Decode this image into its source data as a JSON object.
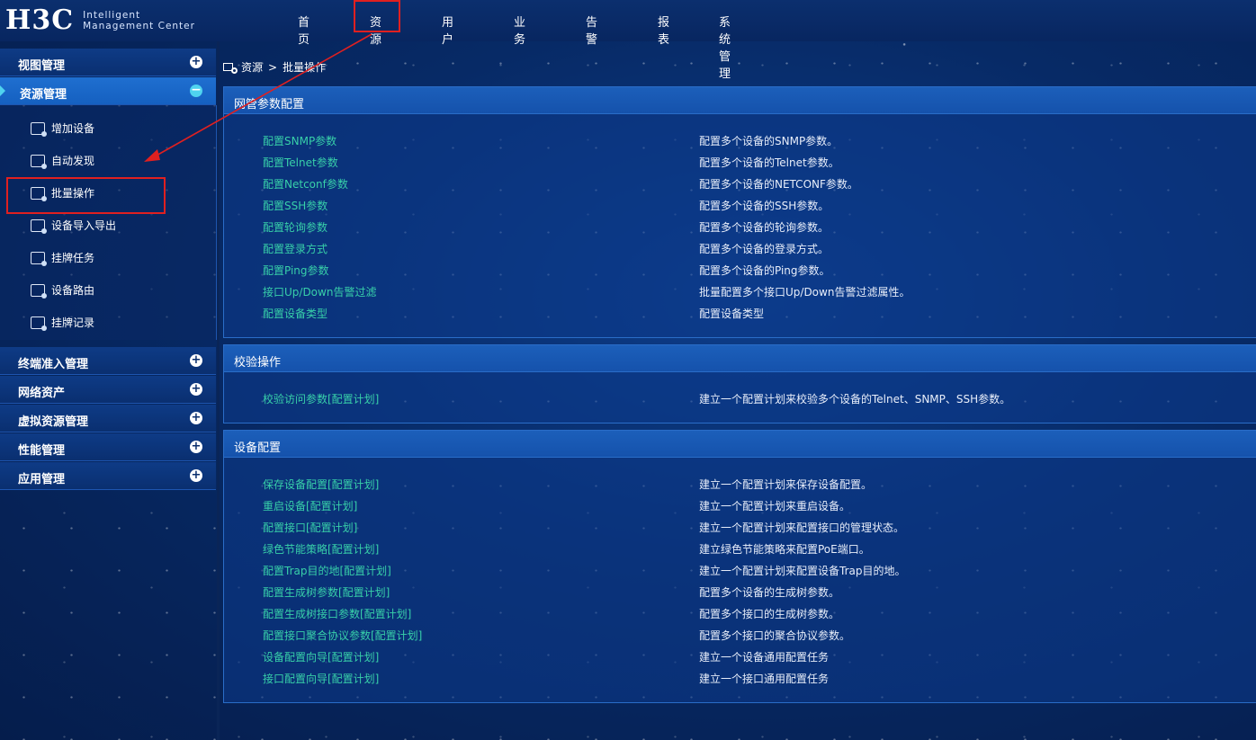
{
  "header": {
    "logo_mark": "H3C",
    "logo_line1": "Intelligent",
    "logo_line2": "Management Center",
    "nav": [
      "首页",
      "资源",
      "用户",
      "业务",
      "告警",
      "报表",
      "系统管理"
    ]
  },
  "sidebar": {
    "sections_top": [
      {
        "label": "视图管理",
        "state": "collapsed"
      },
      {
        "label": "资源管理",
        "state": "expanded"
      }
    ],
    "resource_items": [
      {
        "label": "增加设备",
        "icon": "add-device-icon"
      },
      {
        "label": "自动发现",
        "icon": "auto-discover-icon"
      },
      {
        "label": "批量操作",
        "icon": "batch-operation-icon"
      },
      {
        "label": "设备导入导出",
        "icon": "import-export-icon"
      },
      {
        "label": "挂牌任务",
        "icon": "tag-task-icon"
      },
      {
        "label": "设备路由",
        "icon": "device-route-icon"
      },
      {
        "label": "挂牌记录",
        "icon": "tag-record-icon"
      }
    ],
    "sections_bottom": [
      {
        "label": "终端准入管理"
      },
      {
        "label": "网络资产"
      },
      {
        "label": "虚拟资源管理"
      },
      {
        "label": "性能管理"
      },
      {
        "label": "应用管理"
      }
    ]
  },
  "breadcrumb": {
    "root": "资源",
    "separator": ">",
    "current": "批量操作"
  },
  "panels": [
    {
      "title": "网管参数配置",
      "rows": [
        {
          "link": "配置SNMP参数",
          "desc": "配置多个设备的SNMP参数。"
        },
        {
          "link": "配置Telnet参数",
          "desc": "配置多个设备的Telnet参数。"
        },
        {
          "link": "配置Netconf参数",
          "desc": "配置多个设备的NETCONF参数。"
        },
        {
          "link": "配置SSH参数",
          "desc": "配置多个设备的SSH参数。"
        },
        {
          "link": "配置轮询参数",
          "desc": "配置多个设备的轮询参数。"
        },
        {
          "link": "配置登录方式",
          "desc": "配置多个设备的登录方式。"
        },
        {
          "link": "配置Ping参数",
          "desc": "配置多个设备的Ping参数。"
        },
        {
          "link": "接口Up/Down告警过滤",
          "desc": "批量配置多个接口Up/Down告警过滤属性。"
        },
        {
          "link": "配置设备类型",
          "desc": "配置设备类型"
        }
      ]
    },
    {
      "title": "校验操作",
      "rows": [
        {
          "link": "校验访问参数[配置计划]",
          "desc": "建立一个配置计划来校验多个设备的Telnet、SNMP、SSH参数。"
        }
      ]
    },
    {
      "title": "设备配置",
      "rows": [
        {
          "link": "保存设备配置[配置计划]",
          "desc": "建立一个配置计划来保存设备配置。"
        },
        {
          "link": "重启设备[配置计划]",
          "desc": "建立一个配置计划来重启设备。"
        },
        {
          "link": "配置接口[配置计划]",
          "desc": "建立一个配置计划来配置接口的管理状态。"
        },
        {
          "link": "绿色节能策略[配置计划]",
          "desc": "建立绿色节能策略来配置PoE端口。"
        },
        {
          "link": "配置Trap目的地[配置计划]",
          "desc": "建立一个配置计划来配置设备Trap目的地。"
        },
        {
          "link": "配置生成树参数[配置计划]",
          "desc": "配置多个设备的生成树参数。"
        },
        {
          "link": "配置生成树接口参数[配置计划]",
          "desc": "配置多个接口的生成树参数。"
        },
        {
          "link": "配置接口聚合协议参数[配置计划]",
          "desc": "配置多个接口的聚合协议参数。"
        },
        {
          "link": "设备配置向导[配置计划]",
          "desc": "建立一个设备通用配置任务"
        },
        {
          "link": "接口配置向导[配置计划]",
          "desc": "建立一个接口通用配置任务"
        }
      ]
    }
  ],
  "colors": {
    "link": "#38d0a9",
    "annotation": "#e02020",
    "accent": "#4fd3ef"
  }
}
